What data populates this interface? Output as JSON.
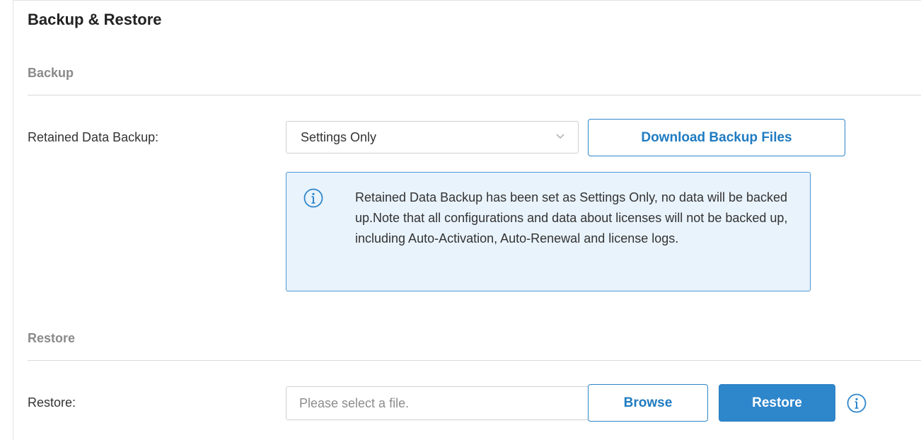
{
  "page": {
    "title": "Backup & Restore"
  },
  "backup": {
    "section_title": "Backup",
    "retained_label": "Retained Data Backup:",
    "retained_value": "Settings Only",
    "download_button": "Download Backup Files",
    "notice_text": "Retained Data Backup has been set as Settings Only, no data will be backed up.Note that all configurations and data about licenses will not be backed up, including Auto-Activation, Auto-Renewal and license logs.",
    "notice_icon": "info-icon"
  },
  "restore": {
    "section_title": "Restore",
    "restore_label": "Restore:",
    "file_placeholder": "Please select a file.",
    "browse_button": "Browse",
    "restore_button": "Restore",
    "help_icon": "info-icon"
  },
  "colors": {
    "accent": "#2e86cb",
    "notice_bg": "#e9f3fc",
    "notice_border": "#4d97d6",
    "section_title": "#8a8a8a"
  }
}
